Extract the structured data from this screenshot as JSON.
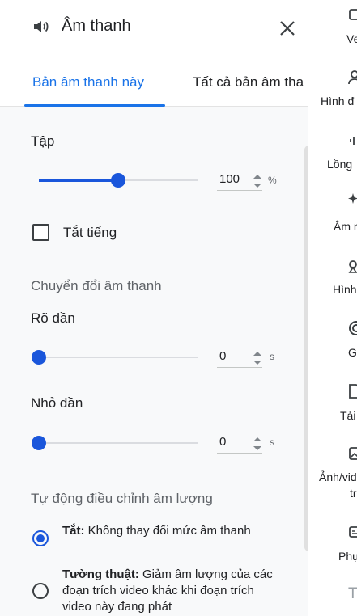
{
  "header": {
    "title": "Âm thanh",
    "speaker_icon": "speaker-icon",
    "close_icon": "close-icon"
  },
  "tabs": [
    {
      "label": "Bản âm thanh này",
      "active": true
    },
    {
      "label": "Tất cả bản âm tha",
      "active": false
    }
  ],
  "volume": {
    "label": "Tập",
    "value": "100",
    "unit": "%",
    "level_percent": 100
  },
  "mute": {
    "label": "Tắt tiếng",
    "checked": false
  },
  "transitions": {
    "title": "Chuyển đổi âm thanh",
    "fade_in": {
      "label": "Rõ dần",
      "value": "0",
      "unit": "s"
    },
    "fade_out": {
      "label": "Nhỏ dần",
      "value": "0",
      "unit": "s"
    }
  },
  "auto_ducking": {
    "title": "Tự động điều chỉnh âm lượng",
    "options": [
      {
        "bold": "Tắt:",
        "text": " Không thay đổi mức âm thanh",
        "selected": true
      },
      {
        "bold": "Tường thuật:",
        "text": " Giảm âm lượng của các đoạn trích video khác khi đoạn trích video này đang phát",
        "selected": false
      }
    ]
  },
  "right_rail": [
    {
      "label": "Ve",
      "icon": "video-icon"
    },
    {
      "label": "Hình đ",
      "icon": "person-icon"
    },
    {
      "label": "Lồng",
      "icon": "voiceover-icon"
    },
    {
      "label": "Âm n",
      "icon": "sparkle-icon"
    },
    {
      "label": "Hình",
      "icon": "shapes-icon"
    },
    {
      "label": "G",
      "icon": "sticker-icon"
    },
    {
      "label": "Tải",
      "icon": "upload-icon"
    },
    {
      "label": "Ảnh/vid",
      "label2": "tr",
      "icon": "media-icon"
    },
    {
      "label": "Phụ",
      "icon": "captions-icon"
    },
    {
      "label": "T",
      "icon": "text-icon"
    }
  ],
  "colors": {
    "accent": "#1a73e8",
    "slider": "#1a56db",
    "panel_bg": "#f8f9fa"
  }
}
